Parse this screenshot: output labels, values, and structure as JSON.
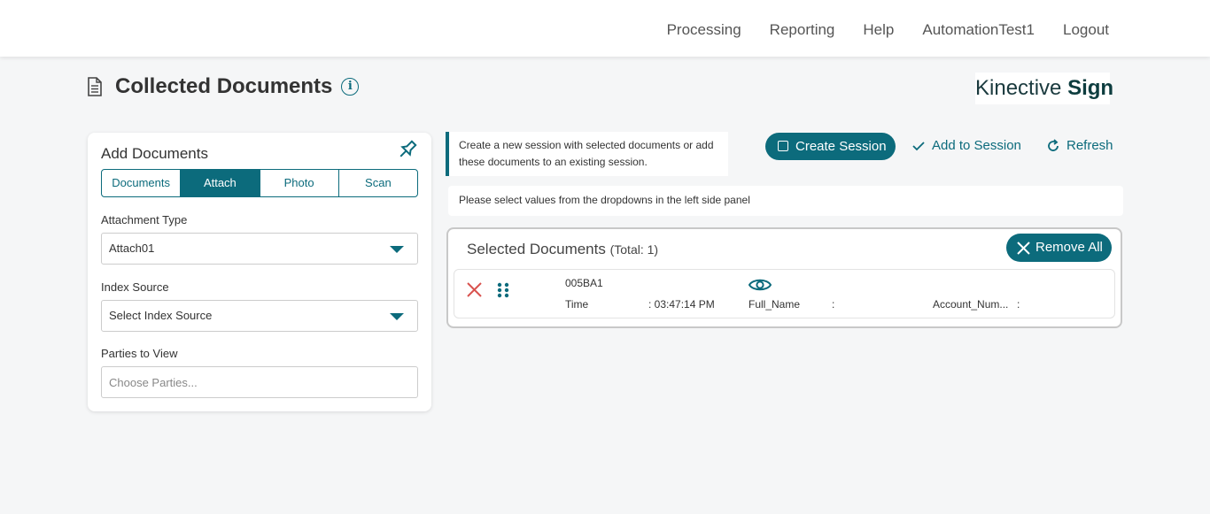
{
  "nav": {
    "items": [
      "Processing",
      "Reporting",
      "Help",
      "AutomationTest1",
      "Logout"
    ]
  },
  "page": {
    "title": "Collected Documents",
    "info_icon": "i"
  },
  "brand": {
    "light": "Kinective",
    "bold": "Sign"
  },
  "add_documents": {
    "title": "Add Documents",
    "tabs": [
      "Documents",
      "Attach",
      "Photo",
      "Scan"
    ],
    "active_tab": "Attach",
    "attachment_type": {
      "label": "Attachment Type",
      "value": "Attach01"
    },
    "index_source": {
      "label": "Index Source",
      "value": "Select Index Source"
    },
    "parties": {
      "label": "Parties to View",
      "placeholder": "Choose Parties..."
    }
  },
  "hint": {
    "text": "Create a new session with selected documents or add these documents to an existing session."
  },
  "actions": {
    "create_session": "Create Session",
    "add_to_session": "Add to Session",
    "refresh": "Refresh"
  },
  "notice": "Please select values from the dropdowns in the left side panel",
  "selected_documents": {
    "title": "Selected Documents",
    "total": "(Total: 1)",
    "remove_all": "Remove All",
    "rows": [
      {
        "name": "005BA1",
        "time_label": "Time",
        "time_value": ": 03:47:14 PM",
        "full_name_label": "Full_Name",
        "full_name_value": ":",
        "account_label": "Account_Num...",
        "account_value": ":"
      }
    ]
  },
  "colors": {
    "accent": "#0c6b7c",
    "danger": "#d9534f",
    "background": "#f5f6f7"
  },
  "icons": {
    "page": "document-icon",
    "info": "info-icon",
    "pin": "pin-icon",
    "create": "square-icon",
    "add": "check-icon",
    "refresh": "refresh-icon",
    "remove_all": "close-icon",
    "row_remove": "x-icon",
    "row_drag": "drag-handle-icon",
    "row_view": "eye-icon"
  }
}
